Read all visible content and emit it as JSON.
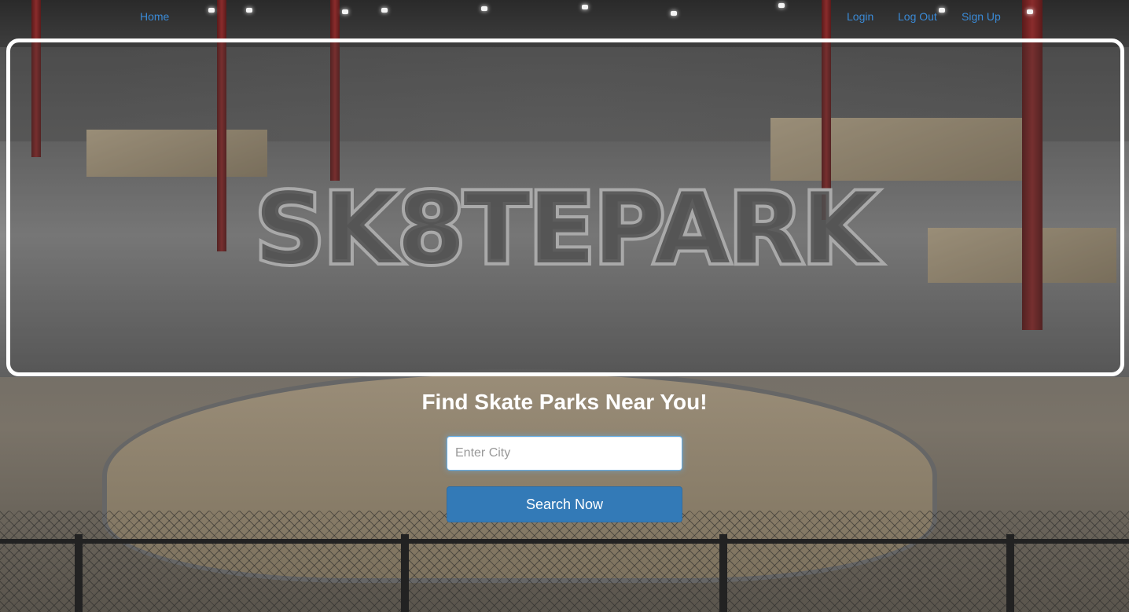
{
  "nav": {
    "home": "Home",
    "login": "Login",
    "logout": "Log Out",
    "signup": "Sign Up"
  },
  "hero": {
    "title": "SK8TEPARK"
  },
  "search": {
    "heading": "Find Skate Parks Near You!",
    "placeholder": "Enter City",
    "value": "",
    "button_label": "Search Now"
  },
  "colors": {
    "link": "#3a8ad6",
    "button": "#337ab7",
    "hero_border": "#ffffff"
  }
}
